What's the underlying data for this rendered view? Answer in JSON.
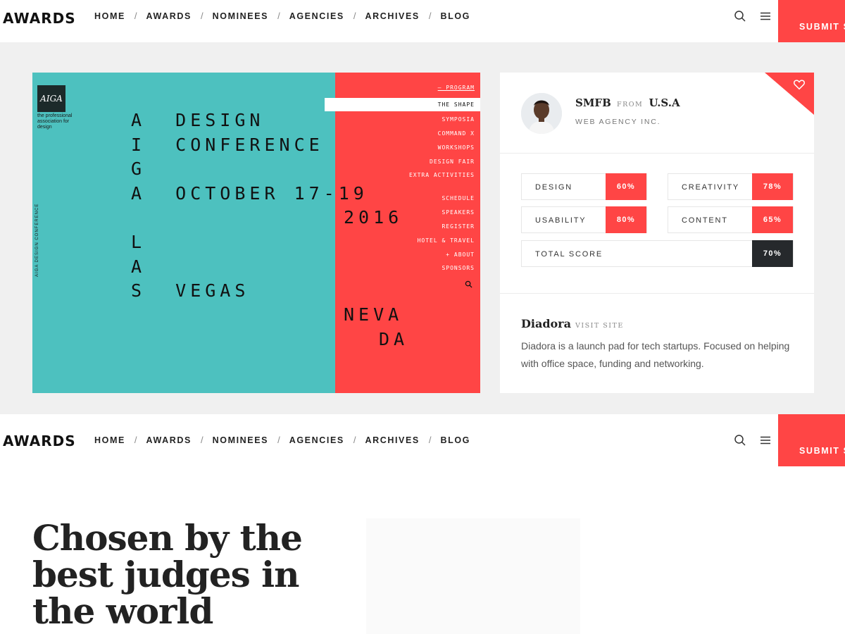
{
  "nav": {
    "logo": "AWARDS",
    "links": [
      "HOME",
      "AWARDS",
      "NOMINEES",
      "AGENCIES",
      "ARCHIVES",
      "BLOG"
    ],
    "separator": "/",
    "submit_label": "SUBMIT S",
    "icons": [
      "search-icon",
      "menu-icon"
    ]
  },
  "poster": {
    "badge": "AIGA",
    "tagline": "the professional association for design",
    "vertical_text": "AIGA DESIGN CONFERENCE",
    "lines": [
      "A  DESIGN",
      "I  CONFERENCE",
      "G",
      "A  OCTOBER 17-19",
      "2016",
      "L",
      "A",
      "S  VEGAS",
      "NEVA",
      "DA"
    ],
    "menu_top": [
      "— PROGRAM"
    ],
    "menu_active": "THE SHAPE",
    "menu_group1": [
      "SYMPOSIA",
      "COMMAND X",
      "WORKSHOPS",
      "DESIGN FAIR",
      "EXTRA ACTIVITIES"
    ],
    "menu_group2": [
      "SCHEDULE",
      "SPEAKERS",
      "REGISTER",
      "HOTEL & TRAVEL",
      "+ ABOUT",
      "SPONSORS"
    ],
    "colors": {
      "teal": "#4dc1bf",
      "red": "#ff4545"
    }
  },
  "card": {
    "agency": "SMFB",
    "from": "FROM",
    "country": "U.S.A",
    "subtitle": "WEB AGENCY INC.",
    "scores": [
      {
        "label": "DESIGN",
        "value": "60%"
      },
      {
        "label": "CREATIVITY",
        "value": "78%"
      },
      {
        "label": "USABILITY",
        "value": "80%"
      },
      {
        "label": "CONTENT",
        "value": "65%"
      }
    ],
    "total": {
      "label": "TOTAL SCORE",
      "value": "70%"
    },
    "client": "Diadora",
    "visit": "VISIT SITE",
    "description": "Diadora is a launch pad for tech startups. Focused on helping with office space, funding and networking.",
    "accent": "#ff4545"
  },
  "hero": {
    "title": "Chosen by the best judges in the world"
  }
}
